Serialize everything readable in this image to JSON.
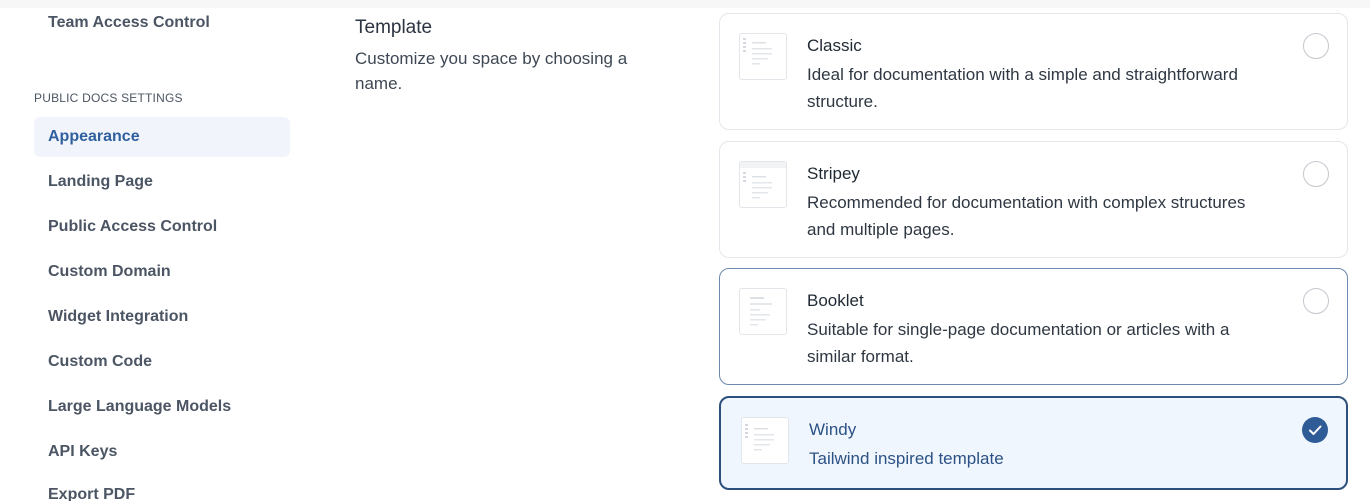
{
  "sidebar": {
    "top_item": "Team Access Control",
    "section_heading": "PUBLIC DOCS SETTINGS",
    "items": [
      {
        "label": "Appearance",
        "active": true
      },
      {
        "label": "Landing Page"
      },
      {
        "label": "Public Access Control"
      },
      {
        "label": "Custom Domain"
      },
      {
        "label": "Widget Integration"
      },
      {
        "label": "Custom Code"
      },
      {
        "label": "Large Language Models"
      },
      {
        "label": "API Keys"
      },
      {
        "label": "Export PDF"
      }
    ]
  },
  "template_section": {
    "title": "Template",
    "description": "Customize you space by choosing a name."
  },
  "templates": [
    {
      "name": "Classic",
      "description": "Ideal for documentation with a simple and straightforward structure.",
      "selected": false
    },
    {
      "name": "Stripey",
      "description": "Recommended for documentation with complex structures and multiple pages.",
      "selected": false
    },
    {
      "name": "Booklet",
      "description": "Suitable for single-page documentation or articles with a similar format.",
      "selected": false
    },
    {
      "name": "Windy",
      "description": "Tailwind inspired template",
      "selected": true
    }
  ],
  "colors": {
    "accent": "#2f5c97",
    "active_bg": "#f1f5fb",
    "selected_bg": "#f0f6fe"
  },
  "icons": {
    "thumbnail": "template-preview-icon",
    "check": "check-icon"
  }
}
